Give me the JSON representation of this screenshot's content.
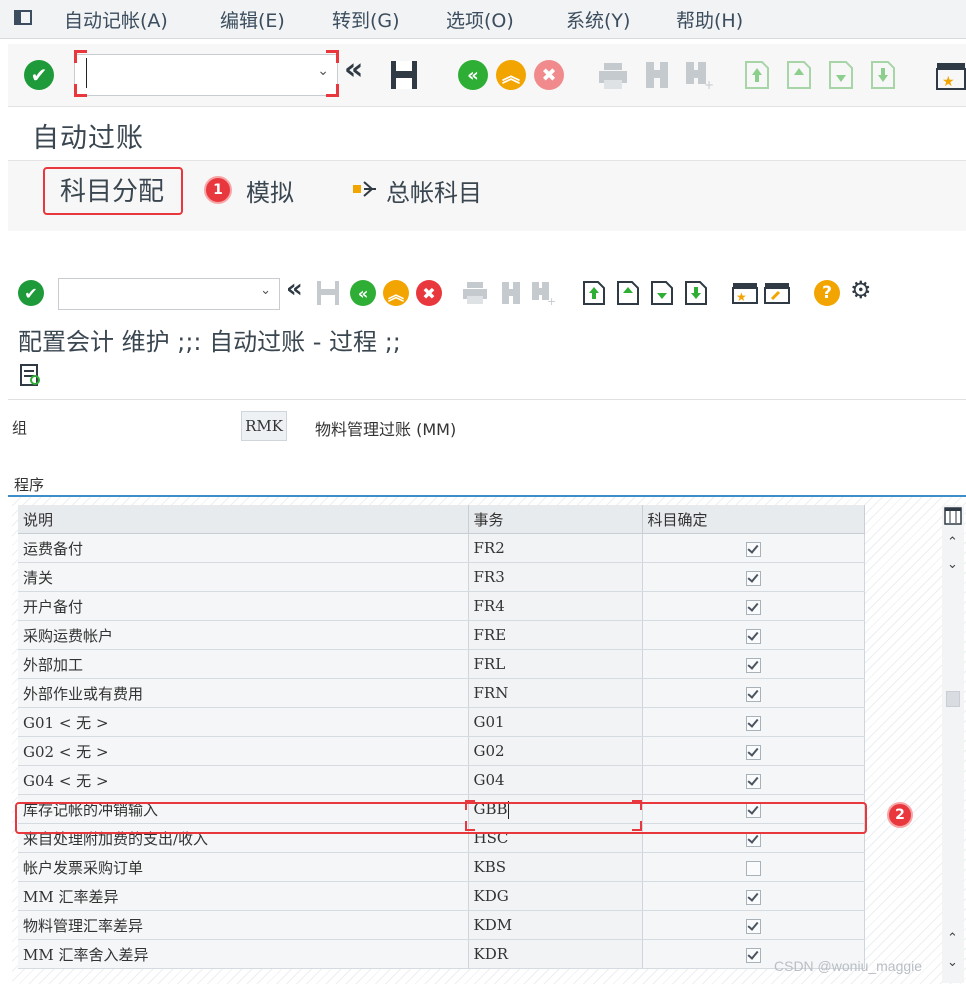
{
  "menu": {
    "items": [
      {
        "label": "自动记帐(A)"
      },
      {
        "label": "编辑(E)"
      },
      {
        "label": "转到(G)"
      },
      {
        "label": "选项(O)"
      },
      {
        "label": "系统(Y)"
      },
      {
        "label": "帮助(H)"
      }
    ]
  },
  "colors": {
    "accent_green": "#1e9a3a",
    "accent_orange": "#f2a400",
    "accent_red": "#e8383d",
    "nav_green": "#2fae36",
    "section_line": "#3c8ec9"
  },
  "window1": {
    "command_field_value": "",
    "title": "自动过账",
    "app_buttons": {
      "assign": "科目分配",
      "simulate": "模拟",
      "gl_accounts": "总帐科目"
    },
    "badge": "1"
  },
  "window2": {
    "command_field_value": "",
    "title": "配置会计 维护 ;;: 自动过账 - 过程 ;;",
    "group_label": "组",
    "group_value": "RMK",
    "group_desc": "物料管理过账 (MM)",
    "section_title": "程序",
    "columns": [
      "说明",
      "事务",
      "科目确定"
    ],
    "rows": [
      {
        "desc": "运费备付",
        "code": "FR2",
        "checked": true
      },
      {
        "desc": "清关",
        "code": "FR3",
        "checked": true
      },
      {
        "desc": "开户备付",
        "code": "FR4",
        "checked": true
      },
      {
        "desc": "采购运费帐户",
        "code": "FRE",
        "checked": true
      },
      {
        "desc": "外部加工",
        "code": "FRL",
        "checked": true
      },
      {
        "desc": "外部作业或有费用",
        "code": "FRN",
        "checked": true
      },
      {
        "desc": "G01 < 无 >",
        "code": "G01",
        "checked": true
      },
      {
        "desc": "G02 < 无 >",
        "code": "G02",
        "checked": true
      },
      {
        "desc": "G04 < 无 >",
        "code": "G04",
        "checked": true
      },
      {
        "desc": "库存记帐的冲销输入",
        "code": "GBB",
        "checked": true
      },
      {
        "desc": "来自处理附加费的支出/收入",
        "code": "HSC",
        "checked": true
      },
      {
        "desc": "帐户发票采购订单",
        "code": "KBS",
        "checked": false
      },
      {
        "desc": "MM 汇率差异",
        "code": "KDG",
        "checked": true
      },
      {
        "desc": "物料管理汇率差异",
        "code": "KDM",
        "checked": true
      },
      {
        "desc": "MM 汇率舍入差异",
        "code": "KDR",
        "checked": true
      }
    ],
    "badge": "2"
  },
  "watermark": "CSDN @woniu_maggie"
}
